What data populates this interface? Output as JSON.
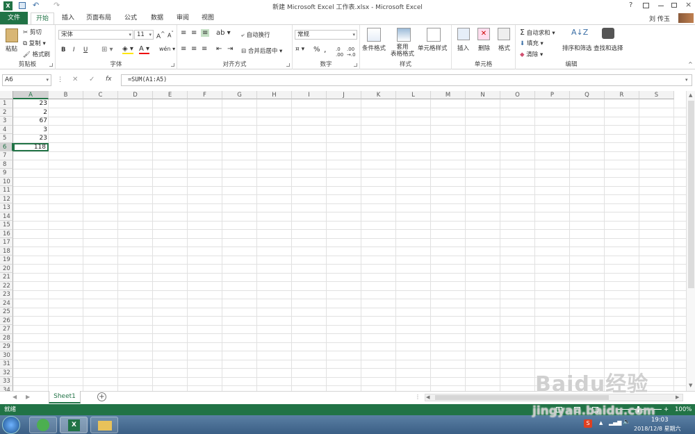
{
  "window": {
    "title": "新建 Microsoft Excel 工作表.xlsx - Microsoft Excel",
    "user": "刘 传玉",
    "help": "?"
  },
  "tabs": [
    "文件",
    "开始",
    "插入",
    "页面布局",
    "公式",
    "数据",
    "审阅",
    "视图"
  ],
  "ribbon": {
    "clipboard": {
      "paste": "粘贴",
      "cut": "剪切",
      "copy": "复制",
      "format_painter": "格式刷",
      "label": "剪贴板"
    },
    "font": {
      "name": "宋体",
      "size": "11",
      "bold": "B",
      "italic": "I",
      "underline": "U",
      "label": "字体"
    },
    "align": {
      "wrap": "自动换行",
      "merge": "合并后居中",
      "label": "对齐方式"
    },
    "number": {
      "format": "常规",
      "percent": "%",
      "comma": ",",
      "label": "数字"
    },
    "styles": {
      "conditional": "条件格式",
      "table1": "套用",
      "table2": "表格格式",
      "cell_styles": "单元格样式",
      "label": "样式"
    },
    "cells": {
      "insert": "插入",
      "delete": "删除",
      "format": "格式",
      "label": "单元格"
    },
    "editing": {
      "autosum": "自动求和",
      "fill": "填充",
      "clear": "清除",
      "sort": "排序和筛选",
      "find": "查找和选择",
      "label": "编辑"
    }
  },
  "formula_bar": {
    "name_box": "A6",
    "formula": "=SUM(A1:A5)",
    "fx": "fx"
  },
  "columns": [
    "A",
    "B",
    "C",
    "D",
    "E",
    "F",
    "G",
    "H",
    "I",
    "J",
    "K",
    "L",
    "M",
    "N",
    "O",
    "P",
    "Q",
    "R",
    "S"
  ],
  "rows": [
    "1",
    "2",
    "3",
    "4",
    "5",
    "6",
    "7",
    "8",
    "9",
    "10",
    "11",
    "12",
    "13",
    "14",
    "15",
    "16",
    "17",
    "18",
    "19",
    "20",
    "21",
    "22",
    "23",
    "24",
    "25",
    "26",
    "27",
    "28",
    "29",
    "30",
    "31",
    "32",
    "33",
    "34"
  ],
  "cells": {
    "A1": "23",
    "A2": "2",
    "A3": "67",
    "A4": "3",
    "A5": "23",
    "A6": "118"
  },
  "sheet": {
    "tab": "Sheet1",
    "add": "+"
  },
  "status": {
    "ready": "就绪",
    "zoom": "100%",
    "minus": "-",
    "plus": "+"
  },
  "taskbar": {
    "time": "19:03",
    "date": "2018/12/8 星期六"
  },
  "watermark": {
    "brand": "Baidu经验",
    "url": "jingyan.baidu.com"
  },
  "colors": {
    "accent": "#217346",
    "selection": "#217346"
  }
}
